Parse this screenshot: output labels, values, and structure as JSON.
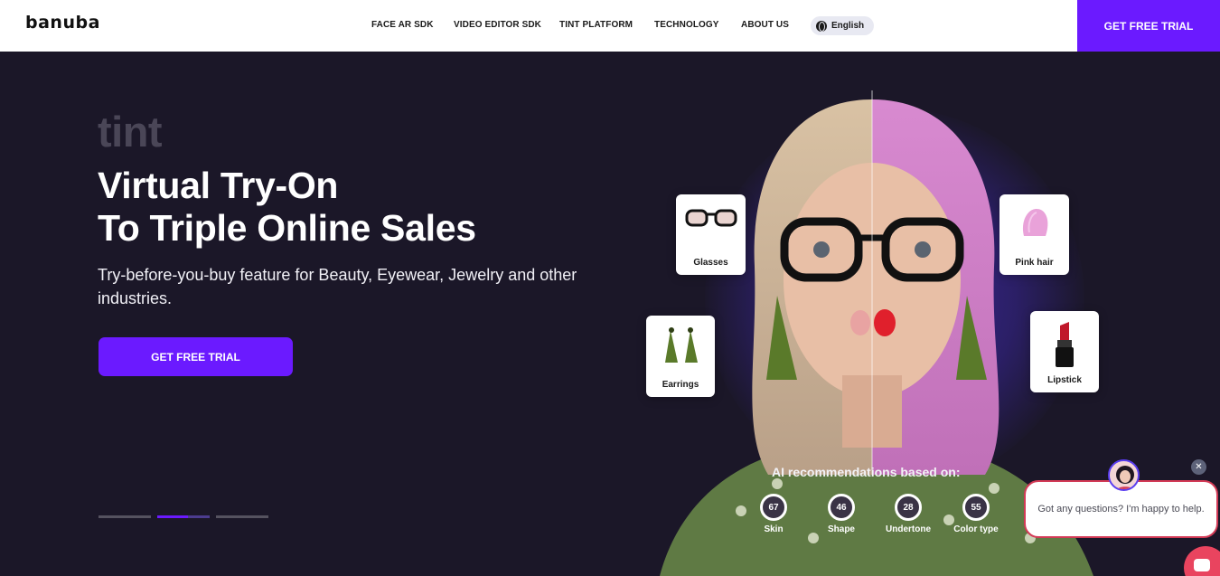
{
  "header": {
    "logo": "banuba",
    "nav": [
      "FACE AR SDK",
      "VIDEO EDITOR SDK",
      "TINT PLATFORM",
      "TECHNOLOGY",
      "ABOUT US"
    ],
    "language": "English",
    "cta": "GET FREE TRIAL"
  },
  "hero": {
    "brand": "tint",
    "headline_line1": "Virtual Try-On",
    "headline_line2": "To Triple Online Sales",
    "subtext": "Try-before-you-buy feature for Beauty, Eyewear, Jewelry and other industries.",
    "cta": "GET FREE TRIAL",
    "slider": {
      "count": 3,
      "active_index": 1
    }
  },
  "visual": {
    "cards": {
      "glasses": "Glasses",
      "pink_hair": "Pink hair",
      "earrings": "Earrings",
      "lipstick": "Lipstick"
    },
    "ai_title": "AI recommendations based on:",
    "metrics": [
      {
        "value": "67",
        "label": "Skin"
      },
      {
        "value": "46",
        "label": "Shape"
      },
      {
        "value": "28",
        "label": "Undertone"
      },
      {
        "value": "55",
        "label": "Color type"
      }
    ]
  },
  "chat": {
    "message": "Got any questions? I'm happy to help.",
    "close_icon": "close-icon"
  },
  "colors": {
    "accent": "#6b1aff",
    "background": "#1b1728",
    "chat_accent": "#e9445f"
  }
}
